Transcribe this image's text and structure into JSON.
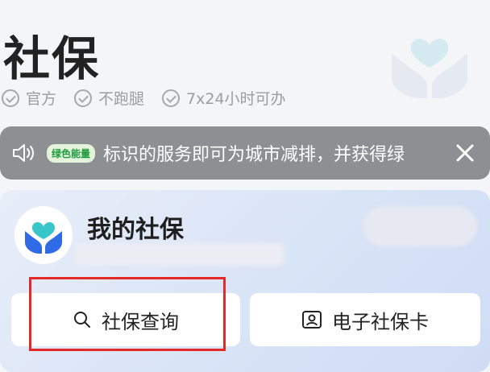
{
  "header": {
    "title": "社保",
    "tags": [
      "官方",
      "不跑腿",
      "7x24小时可办"
    ]
  },
  "notice": {
    "badge": "绿色能量",
    "text": "标识的服务即可为城市减排，并获得绿"
  },
  "card": {
    "title": "我的社保",
    "buttons": {
      "query": "社保查询",
      "ecard": "电子社保卡"
    }
  },
  "colors": {
    "accent_blue": "#2f6be6",
    "heart_teal": "#38c6c9",
    "highlight_red": "#e52929",
    "notice_bg": "#8d8f92"
  },
  "icons": {
    "tag": "check-circle-icon",
    "notice": "speaker-icon",
    "close": "close-icon",
    "query": "search-icon",
    "ecard": "id-card-icon",
    "logo": "hands-heart-icon"
  }
}
